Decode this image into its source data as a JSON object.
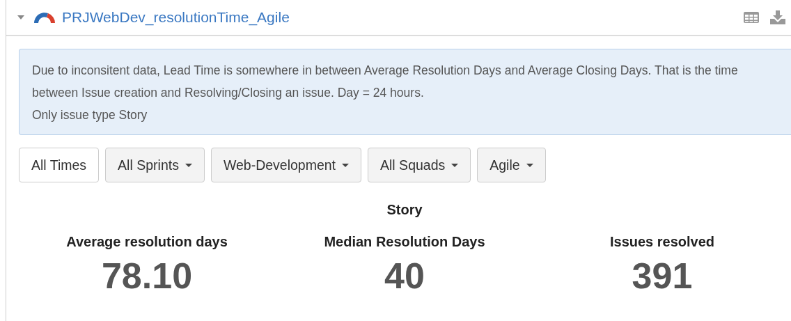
{
  "panel": {
    "title": "PRJWebDev_resolutionTime_Agile",
    "expanded": true
  },
  "info": {
    "lines": [
      "Due to inconsitent data, Lead Time is somewhere in between Average Resolution Days and Average Closing Days. That is the time between Issue creation and Resolving/Closing an issue. Day = 24 hours.",
      "Only issue type Story"
    ]
  },
  "filters": [
    {
      "label": "All Times",
      "kind": "button"
    },
    {
      "label": "All Sprints",
      "kind": "dropdown"
    },
    {
      "label": "Web-Development",
      "kind": "dropdown"
    },
    {
      "label": "All Squads",
      "kind": "dropdown"
    },
    {
      "label": "Agile",
      "kind": "dropdown"
    }
  ],
  "section_title": "Story",
  "stats": [
    {
      "label": "Average resolution days",
      "value": "78.10"
    },
    {
      "label": "Median Resolution Days",
      "value": "40"
    },
    {
      "label": "Issues resolved",
      "value": "391"
    }
  ]
}
